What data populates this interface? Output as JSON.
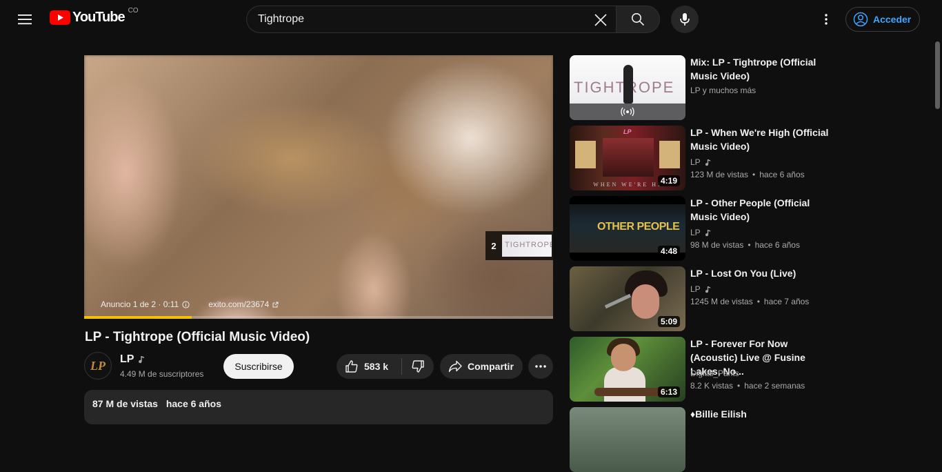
{
  "header": {
    "logo_text": "YouTube",
    "region": "CO",
    "search_value": "Tightrope",
    "signin_label": "Acceder"
  },
  "player": {
    "ad_text": "Anuncio 1 de 2 · 0:11",
    "ad_link": "exito.com/23674",
    "next_ad_number": "2",
    "next_ad_thumb_text": "TIGHTROPE",
    "progress_fraction": 0.23
  },
  "video": {
    "title": "LP - Tightrope (Official Music Video)",
    "channel_name": "LP",
    "channel_avatar_text": "LP",
    "subscribers": "4.49 M de suscriptores",
    "subscribe_label": "Suscribirse",
    "likes": "583 k",
    "share_label": "Compartir",
    "views": "87 M de vistas",
    "published": "hace 6 años"
  },
  "recommendations": [
    {
      "title": "Mix: LP - Tightrope (Official Music Video)",
      "channel": "LP y muchos más",
      "music": false,
      "views": "",
      "age": "",
      "duration": "",
      "thumb": "mix",
      "thumb_text": "TIGHTROPE"
    },
    {
      "title": "LP - When We're High (Official Music Video)",
      "channel": "LP",
      "music": true,
      "views": "123 M de vistas",
      "age": "hace 6 años",
      "duration": "4:19",
      "thumb": "high",
      "thumb_text": "WHEN WE'RE HI"
    },
    {
      "title": "LP - Other People (Official Music Video)",
      "channel": "LP",
      "music": true,
      "views": "98 M de vistas",
      "age": "hace 6 años",
      "duration": "4:48",
      "thumb": "other",
      "thumb_text": "OTHER PEOPLE"
    },
    {
      "title": "LP - Lost On You (Live)",
      "channel": "LP",
      "music": true,
      "views": "1245 M de vistas",
      "age": "hace 7 años",
      "duration": "5:09",
      "thumb": "lost",
      "thumb_text": ""
    },
    {
      "title": "LP - Forever For Now (Acoustic) Live @ Fusine Lakes, No...",
      "channel": "Digital_Pants",
      "music": false,
      "views": "8.2 K vistas",
      "age": "hace 2 semanas",
      "duration": "6:13",
      "thumb": "forever",
      "thumb_text": ""
    },
    {
      "title": "♦Billie Eilish",
      "channel": "",
      "music": false,
      "views": "",
      "age": "",
      "duration": "",
      "thumb": "billie",
      "thumb_text": ""
    }
  ],
  "colors": {
    "background": "#0f0f0f",
    "accent_red": "#ff0000",
    "link_blue": "#3ea6ff",
    "ad_progress": "#f2c200"
  },
  "icons": {
    "menu": "hamburger-icon",
    "clear": "close-icon",
    "search": "search-icon",
    "mic": "microphone-icon",
    "more": "more-vert-icon",
    "account": "account-circle-icon",
    "like": "thumb-up-icon",
    "dislike": "thumb-down-icon",
    "share": "share-icon",
    "more_actions": "more-horiz-icon",
    "music_note": "music-note-icon",
    "info": "info-icon",
    "external": "external-link-icon",
    "mix": "radio-broadcast-icon"
  }
}
